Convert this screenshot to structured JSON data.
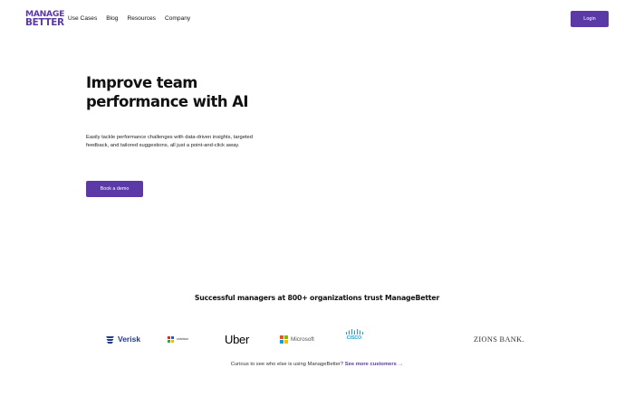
{
  "brand": {
    "logo_line1": "MANAGE",
    "logo_line2": "BETTER",
    "color": "#5b3aa8"
  },
  "nav": {
    "items": [
      {
        "label": "Use Cases"
      },
      {
        "label": "Blog"
      },
      {
        "label": "Resources"
      },
      {
        "label": "Company"
      }
    ],
    "login_label": "Login"
  },
  "hero": {
    "title": "Improve team performance with AI",
    "subtitle": "Easily tackle performance challenges with data-driven insights, targeted feedback, and tailored suggestions, all just a point-and-click away.",
    "cta_label": "Book a demo"
  },
  "trust": {
    "heading": "Successful managers at 800+ organizations trust ManageBetter",
    "logos": {
      "verisk": "Verisk",
      "univision": "univision",
      "uber": "Uber",
      "microsoft": "Microsoft",
      "cisco": "CISCO",
      "zions": "ZIONS BANK."
    },
    "microsoft_colors": [
      "#f25022",
      "#7fba00",
      "#00a4ef",
      "#ffb900"
    ],
    "footer_text": "Curious to see who else is using ManageBetter?",
    "footer_link": "See more customers →"
  }
}
